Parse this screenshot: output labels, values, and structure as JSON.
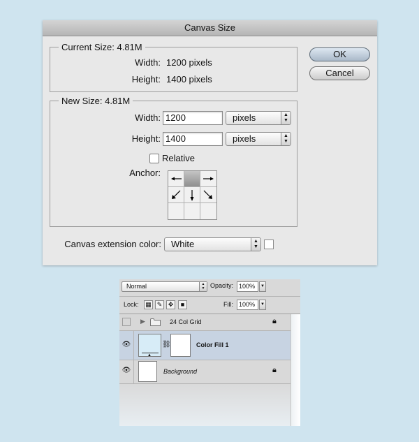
{
  "canvas_dialog": {
    "title": "Canvas Size",
    "current_size": {
      "legend": "Current Size: 4.81M",
      "width_label": "Width:",
      "width_value": "1200 pixels",
      "height_label": "Height:",
      "height_value": "1400 pixels"
    },
    "new_size": {
      "legend": "New Size: 4.81M",
      "width_label": "Width:",
      "width_value": "1200",
      "width_unit": "pixels",
      "height_label": "Height:",
      "height_value": "1400",
      "height_unit": "pixels",
      "relative_label": "Relative",
      "relative_checked": false,
      "anchor_label": "Anchor:"
    },
    "extension_color_label": "Canvas extension color:",
    "extension_color_value": "White",
    "swatch_color": "#ffffff",
    "ok_label": "OK",
    "cancel_label": "Cancel"
  },
  "layers_panel": {
    "blend_mode": "Normal",
    "opacity_label": "Opacity:",
    "opacity_value": "100%",
    "lock_label": "Lock:",
    "fill_label": "Fill:",
    "fill_value": "100%",
    "layers": [
      {
        "name": "24 Col Grid",
        "type": "group",
        "visible": false,
        "locked": true
      },
      {
        "name": "Color Fill 1",
        "type": "fill",
        "visible": true,
        "selected": true,
        "thumb_color": "#d7ecf7"
      },
      {
        "name": "Background",
        "type": "background",
        "visible": true,
        "locked": true
      }
    ]
  },
  "colors": {
    "page_background": "#cfe4ef",
    "selected_row": "#c7d3e2"
  }
}
